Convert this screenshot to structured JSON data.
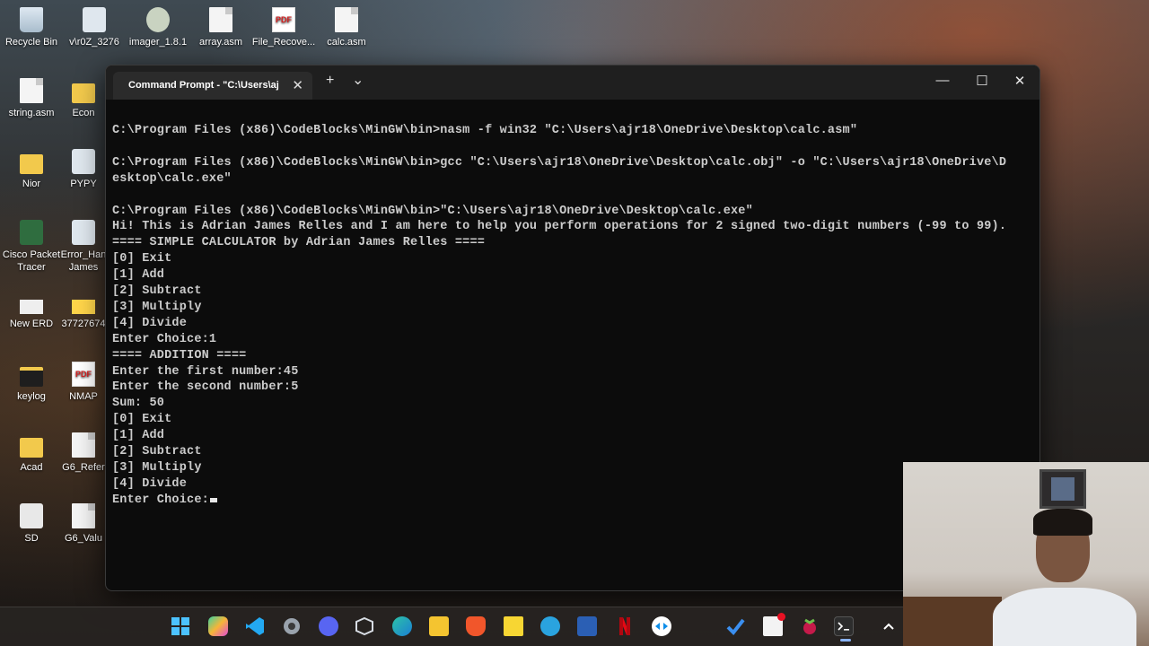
{
  "desktop": {
    "icons": [
      {
        "label": "Recycle Bin",
        "icon": "recycle-bin-icon"
      },
      {
        "label": "v\\r0Z_3276",
        "icon": "python-file-icon"
      },
      {
        "label": "imager_1.8.1",
        "icon": "installer-icon"
      },
      {
        "label": "array.asm",
        "icon": "file-icon"
      },
      {
        "label": "File_Recove...",
        "icon": "pdf-icon"
      },
      {
        "label": "calc.asm",
        "icon": "file-icon"
      },
      {
        "label": "string.asm",
        "icon": "file-icon"
      },
      {
        "label": "Econ",
        "icon": "folder-icon"
      },
      {
        "label": "Nior",
        "icon": "folder-icon"
      },
      {
        "label": "PYPY",
        "icon": "python-file-icon"
      },
      {
        "label": "Cisco Packet\nTracer",
        "icon": "cisco-icon"
      },
      {
        "label": "Error_Han\nJames",
        "icon": "python-file-icon"
      },
      {
        "label": "New ERD",
        "icon": "keyboard-icon"
      },
      {
        "label": "37727674",
        "icon": "image-icon"
      },
      {
        "label": "keylog",
        "icon": "folder-icon"
      },
      {
        "label": "NMAP",
        "icon": "pdf-icon"
      },
      {
        "label": "Acad",
        "icon": "folder-icon"
      },
      {
        "label": "G6_Refer",
        "icon": "file-icon"
      },
      {
        "label": "SD",
        "icon": "gear-icon"
      },
      {
        "label": "G6_Valu",
        "icon": "file-icon"
      }
    ]
  },
  "window": {
    "tab_title": "Command Prompt - \"C:\\Users\\aj",
    "tab_close": "✕",
    "new_tab": "+",
    "dropdown": "⌄",
    "minimize": "—",
    "maximize": "☐",
    "close": "✕"
  },
  "terminal": {
    "lines": [
      "C:\\Program Files (x86)\\CodeBlocks\\MinGW\\bin>nasm -f win32 \"C:\\Users\\ajr18\\OneDrive\\Desktop\\calc.asm\"",
      "",
      "C:\\Program Files (x86)\\CodeBlocks\\MinGW\\bin>gcc \"C:\\Users\\ajr18\\OneDrive\\Desktop\\calc.obj\" -o \"C:\\Users\\ajr18\\OneDrive\\D",
      "esktop\\calc.exe\"",
      "",
      "C:\\Program Files (x86)\\CodeBlocks\\MinGW\\bin>\"C:\\Users\\ajr18\\OneDrive\\Desktop\\calc.exe\"",
      "Hi! This is Adrian James Relles and I am here to help you perform operations for 2 signed two-digit numbers (-99 to 99).",
      "==== SIMPLE CALCULATOR by Adrian James Relles ====",
      "[0] Exit",
      "[1] Add",
      "[2] Subtract",
      "[3] Multiply",
      "[4] Divide",
      "Enter Choice:1",
      "==== ADDITION ====",
      "Enter the first number:45",
      "Enter the second number:5",
      "Sum: 50",
      "[0] Exit",
      "[1] Add",
      "[2] Subtract",
      "[3] Multiply",
      "[4] Divide"
    ],
    "prompt_line": "Enter Choice:"
  },
  "taskbar": {
    "icons": [
      "windows-start-icon",
      "copilot-icon",
      "vscode-icon",
      "settings-icon",
      "discord-icon",
      "virtualbox-icon",
      "edge-icon",
      "file-explorer-icon",
      "brave-icon",
      "sticky-notes-icon",
      "telegram-icon",
      "word-icon",
      "netflix-icon",
      "teamviewer-icon",
      "todo-icon",
      "notepad-icon",
      "raspberry-pi-icon",
      "terminal-icon",
      "chevron-up-icon"
    ]
  }
}
